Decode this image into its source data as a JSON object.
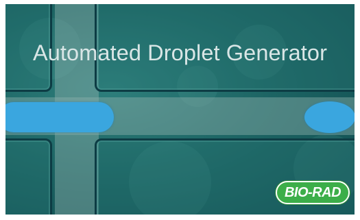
{
  "video": {
    "title": "Automated Droplet Generator",
    "logo_text": "BIO-RAD",
    "colors": {
      "background": "#1d6564",
      "droplet": "#3aa6df",
      "logo_green": "#3cae49",
      "title_text": "#d9e6e6"
    }
  }
}
